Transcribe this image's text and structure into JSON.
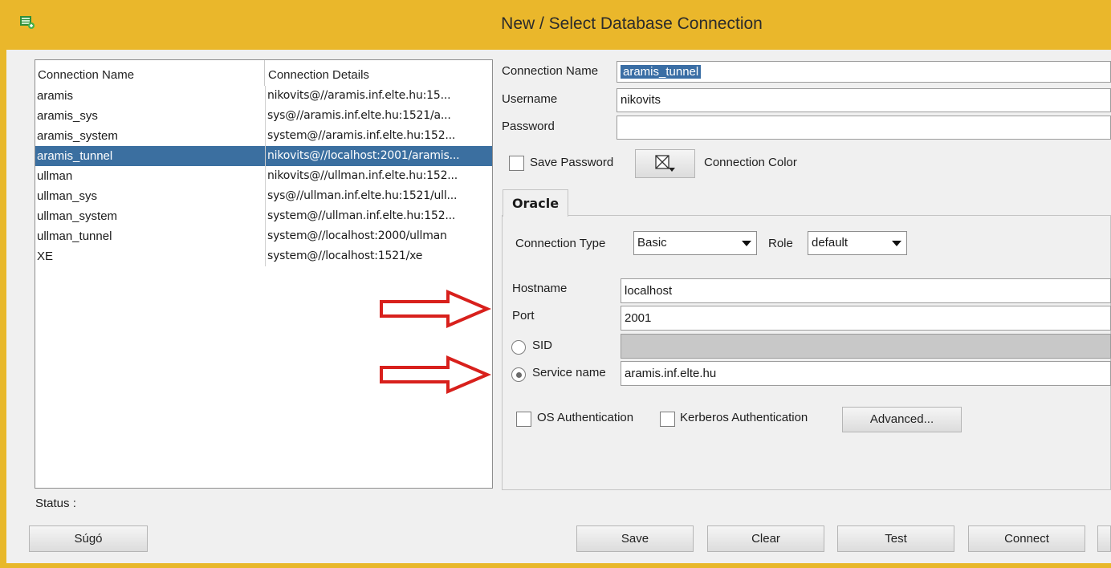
{
  "window": {
    "title": "New / Select Database Connection"
  },
  "list": {
    "columns": [
      "Connection Name",
      "Connection Details"
    ],
    "rows": [
      {
        "name": "aramis",
        "details": "nikovits@//aramis.inf.elte.hu:15..."
      },
      {
        "name": "aramis_sys",
        "details": "sys@//aramis.inf.elte.hu:1521/a..."
      },
      {
        "name": "aramis_system",
        "details": "system@//aramis.inf.elte.hu:152..."
      },
      {
        "name": "aramis_tunnel",
        "details": "nikovits@//localhost:2001/aramis..."
      },
      {
        "name": "ullman",
        "details": "nikovits@//ullman.inf.elte.hu:152..."
      },
      {
        "name": "ullman_sys",
        "details": "sys@//ullman.inf.elte.hu:1521/ull..."
      },
      {
        "name": "ullman_system",
        "details": "system@//ullman.inf.elte.hu:152..."
      },
      {
        "name": "ullman_tunnel",
        "details": "system@//localhost:2000/ullman"
      },
      {
        "name": "XE",
        "details": "system@//localhost:1521/xe"
      }
    ],
    "selected_index": 3
  },
  "form": {
    "conn_name_label": "Connection Name",
    "conn_name_value": "aramis_tunnel",
    "username_label": "Username",
    "username_value": "nikovits",
    "password_label": "Password",
    "password_value": "",
    "save_password_label": "Save Password",
    "connection_color_label": "Connection Color"
  },
  "oracle": {
    "tab_label": "Oracle",
    "conn_type_label": "Connection Type",
    "conn_type_value": "Basic",
    "role_label": "Role",
    "role_value": "default",
    "hostname_label": "Hostname",
    "hostname_value": "localhost",
    "port_label": "Port",
    "port_value": "2001",
    "sid_label": "SID",
    "sid_selected": false,
    "service_name_label": "Service name",
    "service_name_value": "aramis.inf.elte.hu",
    "service_name_selected": true,
    "os_auth_label": "OS Authentication",
    "kerberos_label": "Kerberos Authentication",
    "advanced_label": "Advanced..."
  },
  "status": {
    "label": "Status :"
  },
  "buttons": {
    "help": "Súgó",
    "save": "Save",
    "clear": "Clear",
    "test": "Test",
    "connect": "Connect"
  },
  "colors": {
    "title_bar": "#eab72b",
    "selection": "#3b6fa0",
    "annotation_arrow": "#d8201c"
  },
  "icons": [
    "app-icon",
    "color-picker-icon",
    "dropdown-arrow-icon"
  ]
}
